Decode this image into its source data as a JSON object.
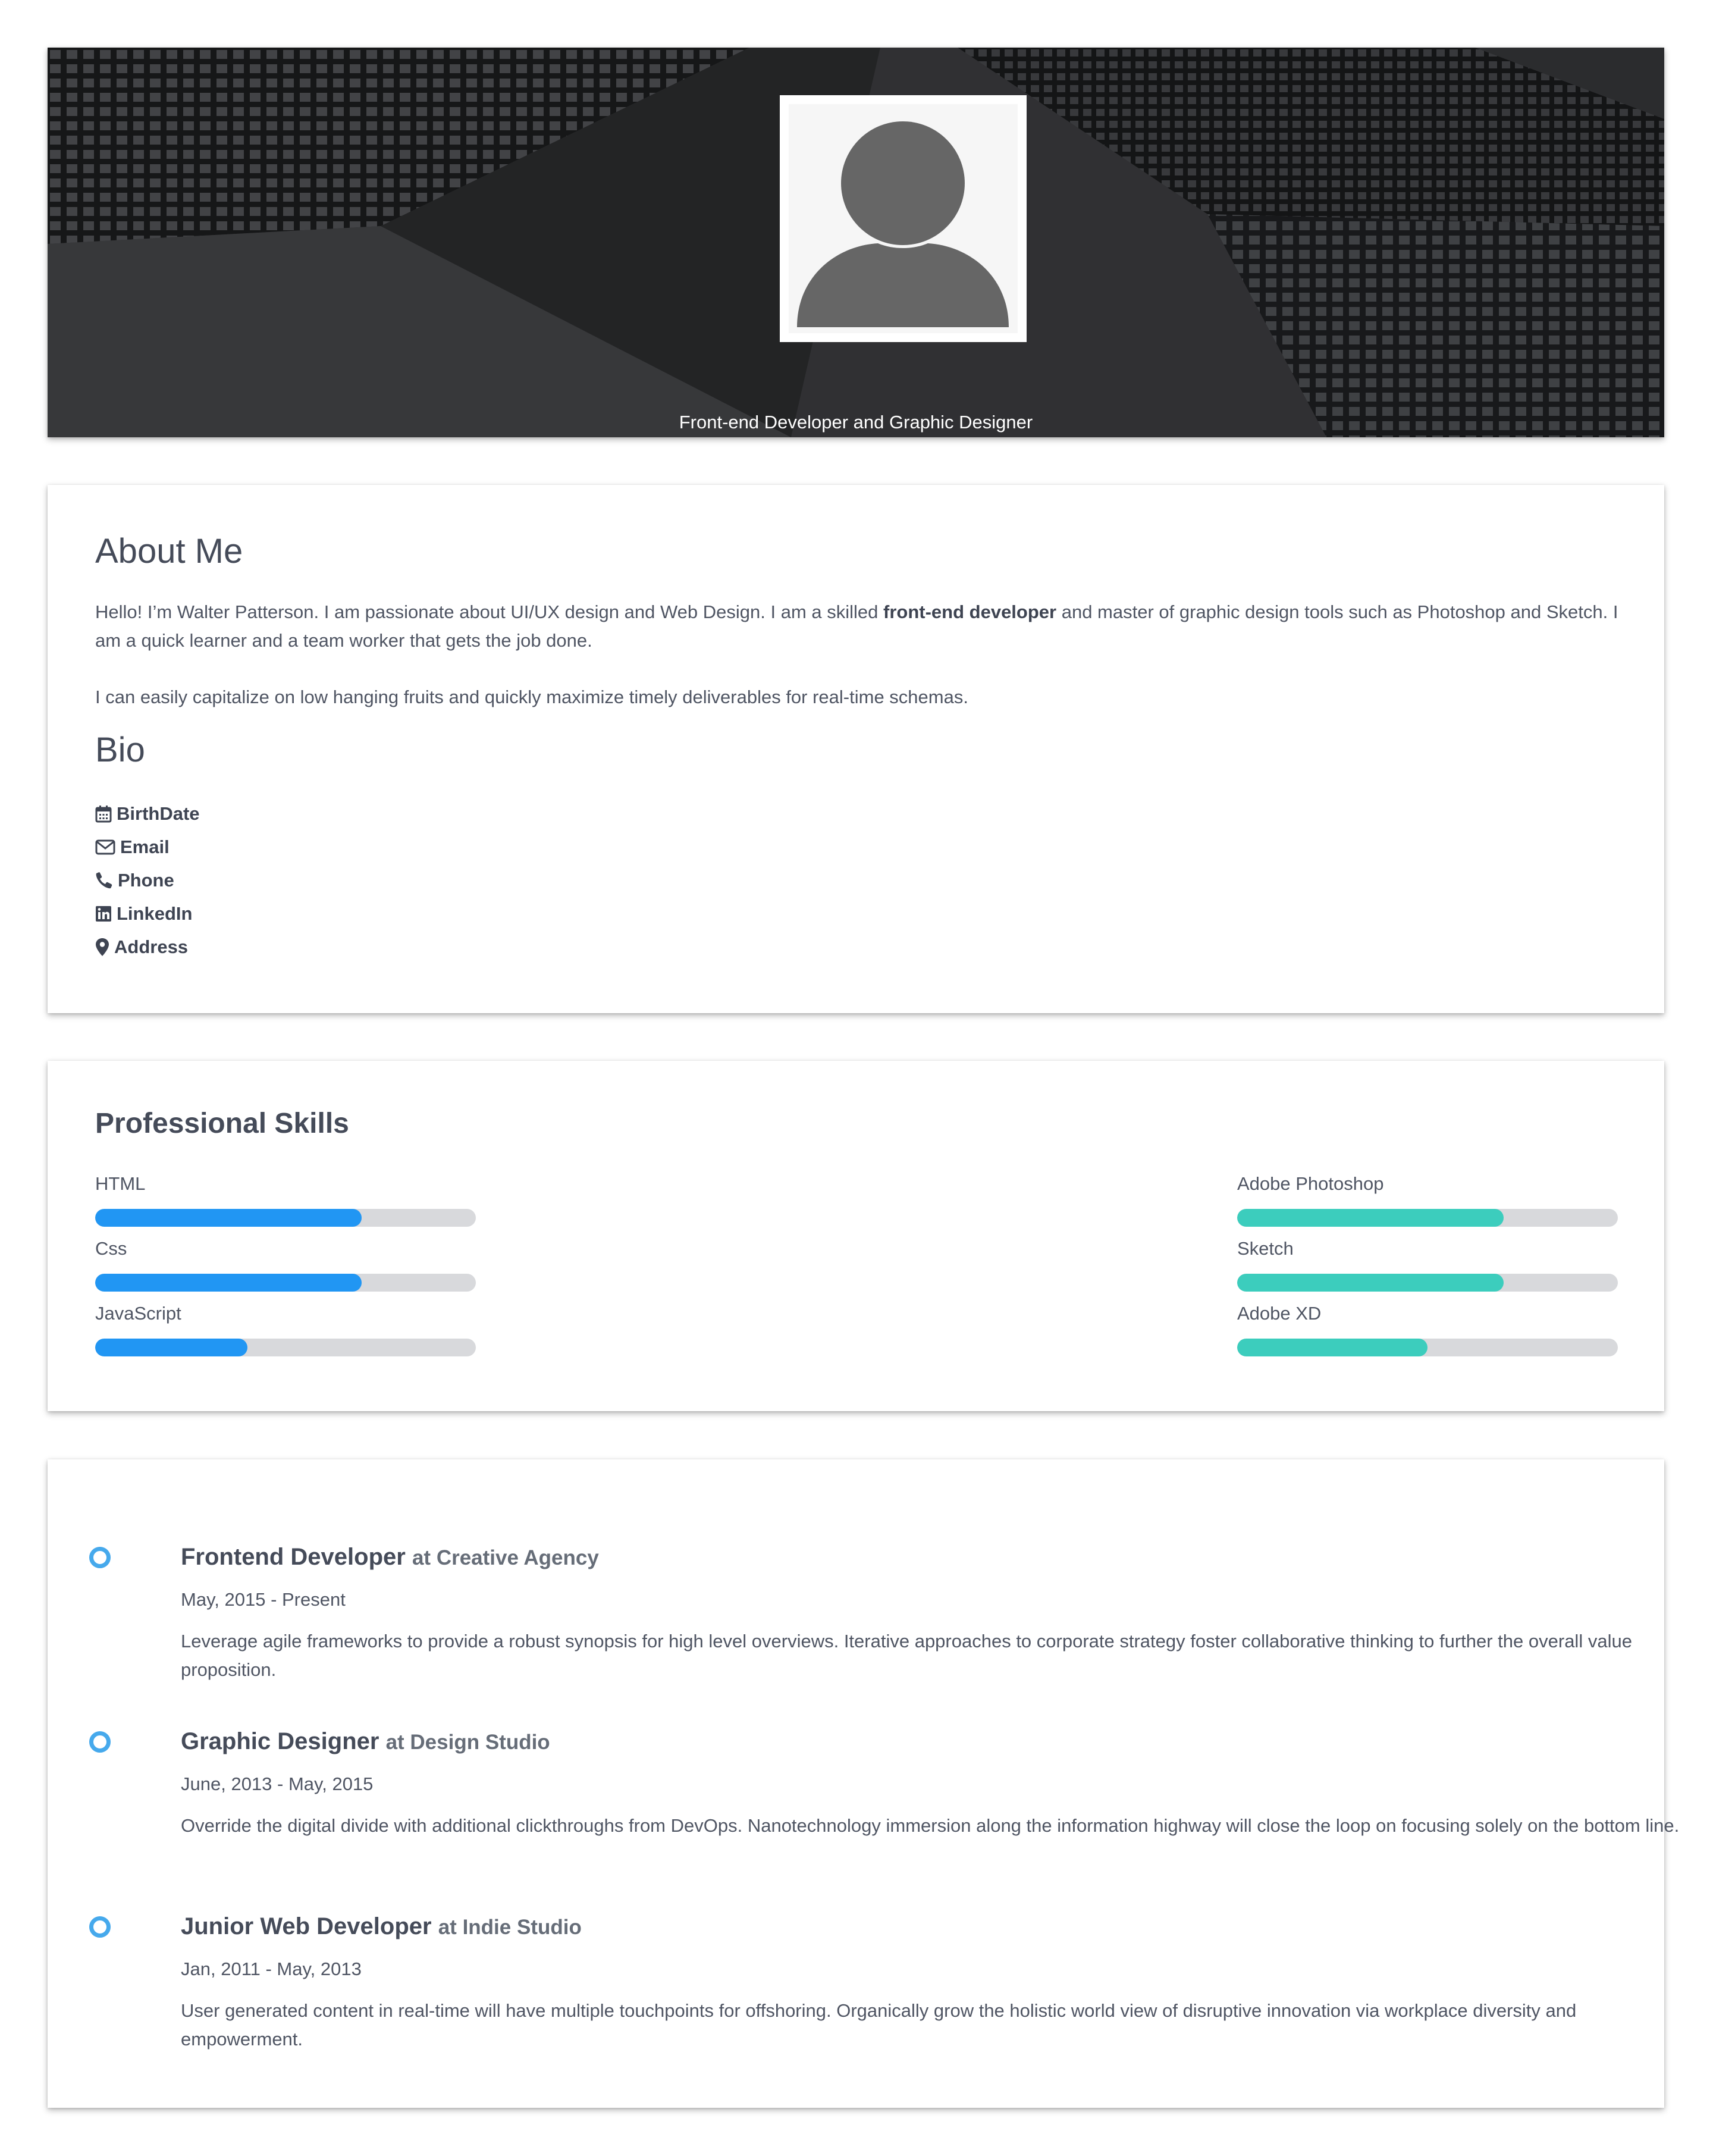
{
  "header": {
    "subtitle": "Front-end Developer and Graphic Designer"
  },
  "about": {
    "title": "About Me",
    "para1_before": "Hello! I’m Walter Patterson. I am passionate about UI/UX design and Web Design. I am a skilled ",
    "para1_bold": "front-end developer",
    "para1_after": " and master of graphic design tools such as Photoshop and Sketch. I am a quick learner and a team worker that gets the job done.",
    "para2": "I can easily capitalize on low hanging fruits and quickly maximize timely deliverables for real-time schemas."
  },
  "bio": {
    "title": "Bio",
    "items": [
      {
        "label": "BirthDate",
        "icon": "calendar-icon"
      },
      {
        "label": "Email",
        "icon": "envelope-icon"
      },
      {
        "label": "Phone",
        "icon": "phone-icon"
      },
      {
        "label": "LinkedIn",
        "icon": "linkedin-icon"
      },
      {
        "label": "Address",
        "icon": "map-marker-icon"
      }
    ]
  },
  "skills": {
    "title": "Professional Skills",
    "colors": {
      "dev": "#2196f3",
      "design": "#3ccdbd"
    },
    "left": [
      {
        "name": "HTML",
        "level": 0.7
      },
      {
        "name": "Css",
        "level": 0.7
      },
      {
        "name": "JavaScript",
        "level": 0.4
      }
    ],
    "right": [
      {
        "name": "Adobe Photoshop",
        "level": 0.7
      },
      {
        "name": "Sketch",
        "level": 0.7
      },
      {
        "name": "Adobe XD",
        "level": 0.5
      }
    ]
  },
  "experience": [
    {
      "role": "Frontend Developer",
      "company": "at Creative Agency",
      "dates": "May, 2015 - Present",
      "description": "Leverage agile frameworks to provide a robust synopsis for high level overviews. Iterative approaches to corporate strategy foster collaborative thinking to further the overall value proposition."
    },
    {
      "role": "Graphic Designer",
      "company": "at Design Studio",
      "dates": "June, 2013 - May, 2015",
      "description": "Override the digital divide with additional clickthroughs from DevOps. Nanotechnology immersion along the information highway will close the loop on focusing solely on the bottom line."
    },
    {
      "role": "Junior Web Developer",
      "company": "at Indie Studio",
      "dates": "Jan, 2011 - May, 2013",
      "description": "User generated content in real-time will have multiple touchpoints for offshoring. Organically grow the holistic world view of disruptive innovation via workplace diversity and empowerment."
    }
  ]
}
